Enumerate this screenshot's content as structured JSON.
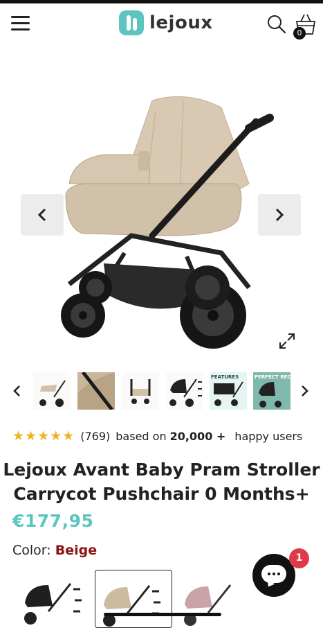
{
  "header": {
    "logo_text": "lejoux",
    "cart_count": "0",
    "menu_icon": "hamburger-icon",
    "search_icon": "search-icon",
    "cart_icon": "basket-icon"
  },
  "gallery": {
    "image_alt": "Beige pram stroller with carrycot",
    "prev_icon": "chevron-left-icon",
    "next_icon": "chevron-right-icon",
    "expand_icon": "expand-icon"
  },
  "thumbnails": [
    {
      "label": ""
    },
    {
      "label": ""
    },
    {
      "label": ""
    },
    {
      "label": ""
    },
    {
      "label": "FEATURES"
    },
    {
      "label": "PERFECT RECLINE"
    }
  ],
  "rating": {
    "stars": 5,
    "count_text": "(769)",
    "based_on": "based on",
    "users_count": "20,000 +",
    "users_text": "happy users"
  },
  "product": {
    "title": "Lejoux Avant Baby Pram Stroller Carrycot Pushchair 0 Months+",
    "price": "€177,95",
    "color_label": "Color:",
    "color_value": "Beige"
  },
  "swatches": [
    {
      "name": "Black",
      "selected": false
    },
    {
      "name": "Beige",
      "selected": true
    },
    {
      "name": "Pink",
      "selected": false
    }
  ],
  "chat": {
    "badge": "1"
  },
  "colors": {
    "brand": "#5cc5c0",
    "color_value": "#8b1414",
    "star": "#f0b423",
    "badge": "#e03a4a"
  }
}
